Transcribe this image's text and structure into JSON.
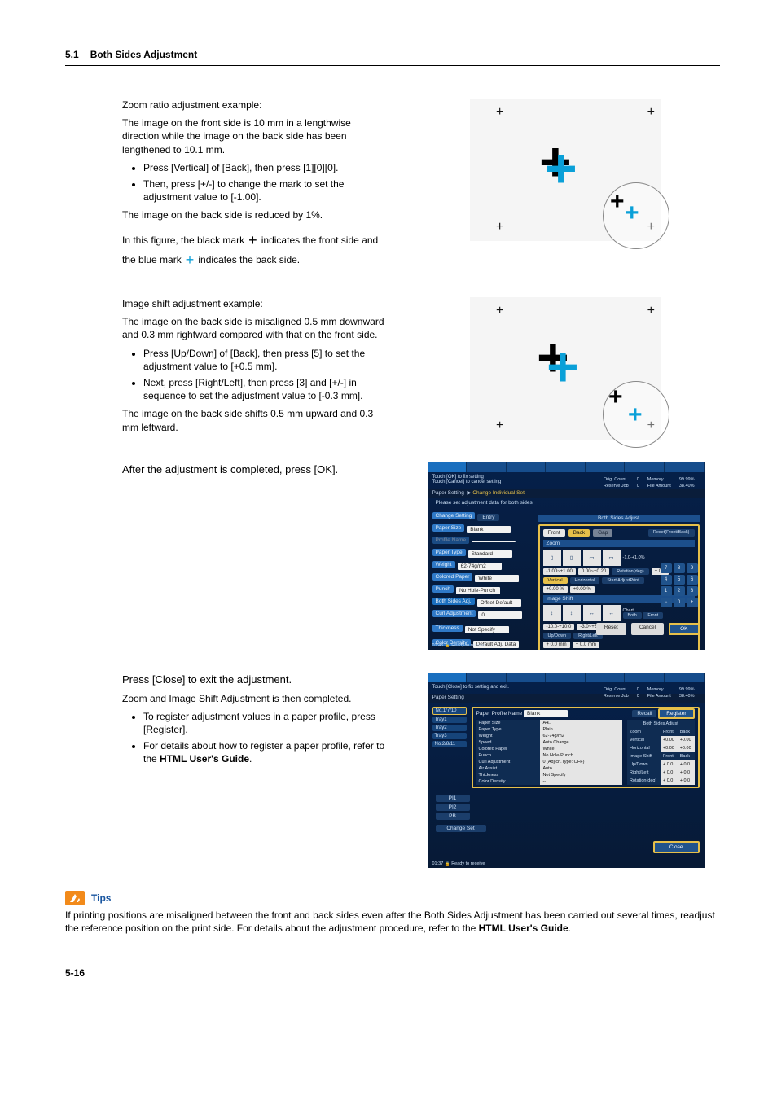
{
  "header": {
    "number": "5.1",
    "title": "Both Sides Adjustment"
  },
  "zoom_example": {
    "heading": "Zoom ratio adjustment example:",
    "p1a": "The image on the front side is 10 mm in a lengthwise direction while the image on the back side has been lengthened to 10.1 mm.",
    "b1": "Press [Vertical] of [Back], then press [1][0][0].",
    "b2": "Then, press [+/-] to change the mark to set the adjustment value to [-1.00].",
    "p2": "The image on the back side is reduced by 1%.",
    "p3a": "In this figure, the black mark ",
    "p3b": " indicates the front side and the blue mark ",
    "p3c": " indicates the back side."
  },
  "shift_example": {
    "heading": "Image shift adjustment example:",
    "p1": "The image on the back side is misaligned 0.5 mm downward and 0.3 mm rightward compared with that on the front side.",
    "b1": "Press [Up/Down] of [Back], then press [5] to set the adjustment value to [+0.5 mm].",
    "b2": "Next, press [Right/Left], then press [3] and [+/-] in sequence to set the adjustment value to [-0.3 mm].",
    "p2": "The image on the back side shifts 0.5 mm upward and 0.3 mm leftward."
  },
  "after_adjust": "After the adjustment is completed, press [OK].",
  "close_step": {
    "heading": "Press [Close] to exit the adjustment.",
    "p1": "Zoom and Image Shift Adjustment is then completed.",
    "b1": "To register adjustment values in a paper profile, press [Register].",
    "b2a": "For details about how to register a paper profile, refer to the ",
    "b2b": "HTML User's Guide",
    "b2c": "."
  },
  "tips": {
    "label": "Tips",
    "body_a": "If printing positions are misaligned between the front and back sides even after the Both Sides Adjustment has been carried out several times, readjust the reference position on the print side. For details about the adjustment procedure, refer to the ",
    "body_b": "HTML User's Guide",
    "body_c": "."
  },
  "page_number": "5-16",
  "screen1": {
    "info": "Touch [OK] to fix setting\nTouch [Cancel] to cancel setting",
    "status": {
      "orig": "Orig. Count",
      "orig_v": "0",
      "mem": "Memory",
      "mem_v": "99.99%",
      "res": "Reserve Job",
      "res_v": "0",
      "file": "File Amount",
      "file_v": "38.40%"
    },
    "crumb_a": "Paper Setting",
    "crumb_b": "Change Individual Set",
    "prompt": "Please set adjustment data for both sides.",
    "left_head": "Change Setting",
    "left_tab": "Entry",
    "both_sides": "Both Sides Adjust",
    "paper_size": "Paper Size",
    "paper_size_v": "Blank",
    "profile_name": "Profile Name",
    "profile_name_v": "",
    "paper_type": "Paper Type",
    "paper_type_v": "Standard",
    "weight": "Weight",
    "weight_v": "62-74g/m2",
    "colored": "Colored Paper",
    "colored_v": "White",
    "punch": "Punch",
    "punch_v": "No Hole-Punch",
    "both_adj": "Both Sides Adj.",
    "both_adj_v": "Offset Default",
    "curl": "Curl Adjustment",
    "curl_v": "0",
    "thick": "Thickness",
    "thick_v": "Not Specify",
    "density": "Color Density",
    "density_v": "Default Adj. Data",
    "tab_front": "Front",
    "tab_back": "Back",
    "tab_gap": "Gap",
    "reset": "Reset(Front/Back)",
    "zoom": "Zoom",
    "zoom_range": "-1.0-+1.0%",
    "vertical": "Vertical",
    "horizontal": "Horizontal",
    "zoom_v1": "-1.00~+1.00",
    "zoom_v2": "0.00~+0.20",
    "zoom_v3": "+0.00 %",
    "zoom_v4": "+0.00 %",
    "rotation": "Rotation(deg)",
    "rotation_v": "+ 0.0",
    "start": "Start AdjustPrint",
    "imgshift": "Image Shift",
    "is_range": "-10.0-+10.0",
    "is_range2": "-3.0~+3.0",
    "updown": "Up/Down",
    "rightleft": "Right/Left",
    "is_v1": "+ 0.0 mm",
    "is_v2": "+ 0.0 mm",
    "chart": "Chart",
    "both": "Both",
    "front": "Front",
    "keys": [
      "7",
      "8",
      "9",
      "4",
      "5",
      "6",
      "1",
      "2",
      "3",
      "−",
      "0",
      "±"
    ],
    "btn_reset": "Reset",
    "btn_cancel": "Cancel",
    "btn_ok": "OK",
    "timefoot": "01:45",
    "ready": "Ready to receive"
  },
  "screen2": {
    "info": "Touch [Close] to fix setting and exit.",
    "status": {
      "orig": "Orig. Count",
      "orig_v": "0",
      "mem": "Memory",
      "mem_v": "99.99%",
      "res": "Reserve Job",
      "res_v": "0",
      "file": "File Amount",
      "file_v": "38.40%"
    },
    "crumb": "Paper Setting",
    "trays": [
      "No.1/7/10",
      "Tray1",
      "Tray2",
      "Tray3",
      "No.2/8/11"
    ],
    "profile_name": "Paper Profile Name",
    "profile_name_v": "Blank",
    "recall": "Recall",
    "register": "Register",
    "rows": [
      [
        "Paper Size",
        "A4□"
      ],
      [
        "Paper Type",
        "Plain"
      ],
      [
        "Weight",
        "62-74g/m2"
      ],
      [
        "Speed",
        "Auto Change"
      ],
      [
        "Colored Paper",
        "White"
      ],
      [
        "Punch",
        "No Hole-Punch"
      ],
      [
        "Curl Adjustment",
        "0 (Adj.cri.Type: OFF)"
      ],
      [
        "Air Assist",
        "Auto"
      ],
      [
        "Thickness",
        "Not Specify"
      ],
      [
        "Color Density",
        "--"
      ]
    ],
    "rhead": "Both Sides Adjust",
    "rcol_front": "Front",
    "rcol_back": "Back",
    "rrows_zoom": "Zoom",
    "rrows_vert": "Vertical",
    "rrows_horz": "Horizontal",
    "rv1": "+0.00",
    "rv2": "+0.00",
    "rv3": "+0.00",
    "rv4": "+0.00",
    "rrows_shift": "Image Shift",
    "rrows_ud": "Up/Down",
    "rrows_rl": "Right/Left",
    "rrows_rot": "Rotation(deg)",
    "rs1": "+ 0.0",
    "rs2": "+ 0.0",
    "rs3": "+ 0.0",
    "rs4": "+ 0.0",
    "rs5": "+ 0.0",
    "rs6": "+ 0.0",
    "pi1": "PI1",
    "pi2": "PI2",
    "pb": "PB",
    "change_set": "Change Set",
    "close": "Close",
    "timefoot": "01:37",
    "ready": "Ready to receive"
  }
}
